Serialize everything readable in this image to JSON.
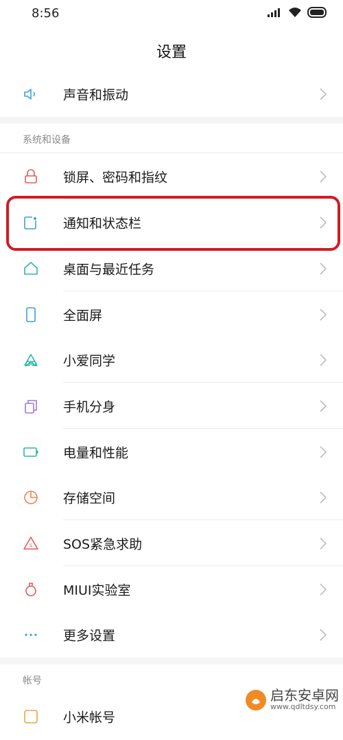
{
  "status": {
    "time": "8:56"
  },
  "title": "设置",
  "rows": [
    {
      "label": "声音和振动"
    },
    {
      "label": "锁屏、密码和指纹"
    },
    {
      "label": "通知和状态栏"
    },
    {
      "label": "桌面与最近任务"
    },
    {
      "label": "全面屏"
    },
    {
      "label": "小爱同学"
    },
    {
      "label": "手机分身"
    },
    {
      "label": "电量和性能"
    },
    {
      "label": "存储空间"
    },
    {
      "label": "SOS紧急求助"
    },
    {
      "label": "MIUI实验室"
    },
    {
      "label": "更多设置"
    },
    {
      "label": "小米帐号"
    }
  ],
  "sections": {
    "system": "系统和设备",
    "account": "帐号"
  },
  "watermark": {
    "main": "启东安卓网",
    "sub": "www.qdltdsy.com"
  },
  "colors": {
    "highlight": "#d31a22",
    "chevron": "#bdbdbd"
  }
}
